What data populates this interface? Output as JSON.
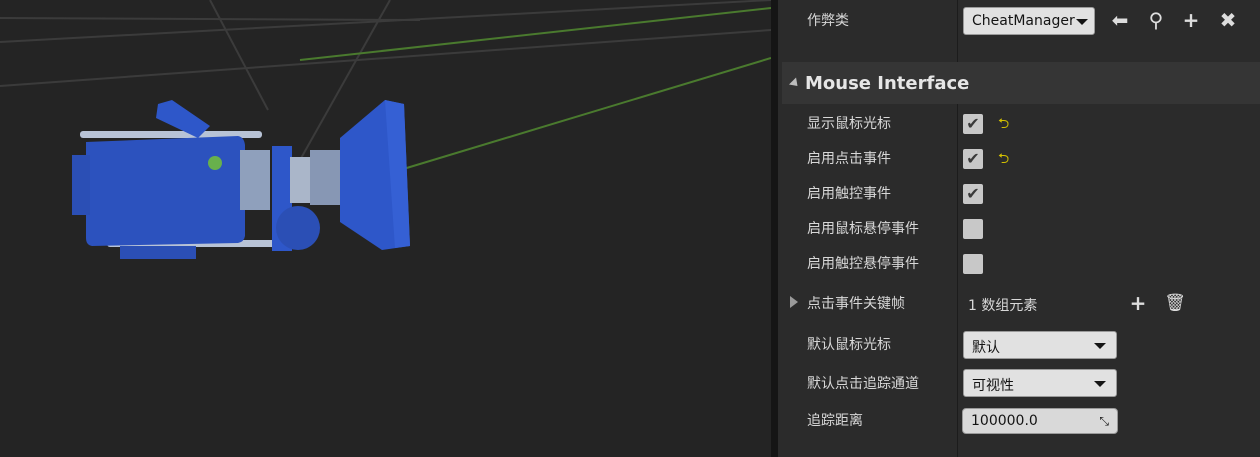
{
  "viewport": {
    "icon": "camera-actor-icon"
  },
  "details": {
    "cheat": {
      "label": "作弊类",
      "value": "CheatManager",
      "icons": [
        "arrow-left-icon",
        "search-icon",
        "plus-icon",
        "close-icon"
      ]
    },
    "category": {
      "title": "Mouse Interface"
    },
    "rows": [
      {
        "label": "显示鼠标光标",
        "checked": true,
        "reset": "⮌"
      },
      {
        "label": "启用点击事件",
        "checked": true,
        "reset": "⮌"
      },
      {
        "label": "启用触控事件",
        "checked": true
      },
      {
        "label": "启用鼠标悬停事件",
        "checked": false
      },
      {
        "label": "启用触控悬停事件",
        "checked": false
      }
    ],
    "array": {
      "label": "点击事件关键帧",
      "value": "1 数组元素"
    },
    "default_cursor": {
      "label": "默认鼠标光标",
      "value": "默认"
    },
    "default_trace": {
      "label": "默认点击追踪通道",
      "value": "可视性"
    },
    "trace_distance": {
      "label": "追踪距离",
      "value": "100000.0"
    },
    "colors": {
      "panel_bg": "#2b2b2b",
      "header_bg": "#353535",
      "reset_yellow": "#d4c100",
      "camera_blue": "#2e57c9"
    }
  }
}
